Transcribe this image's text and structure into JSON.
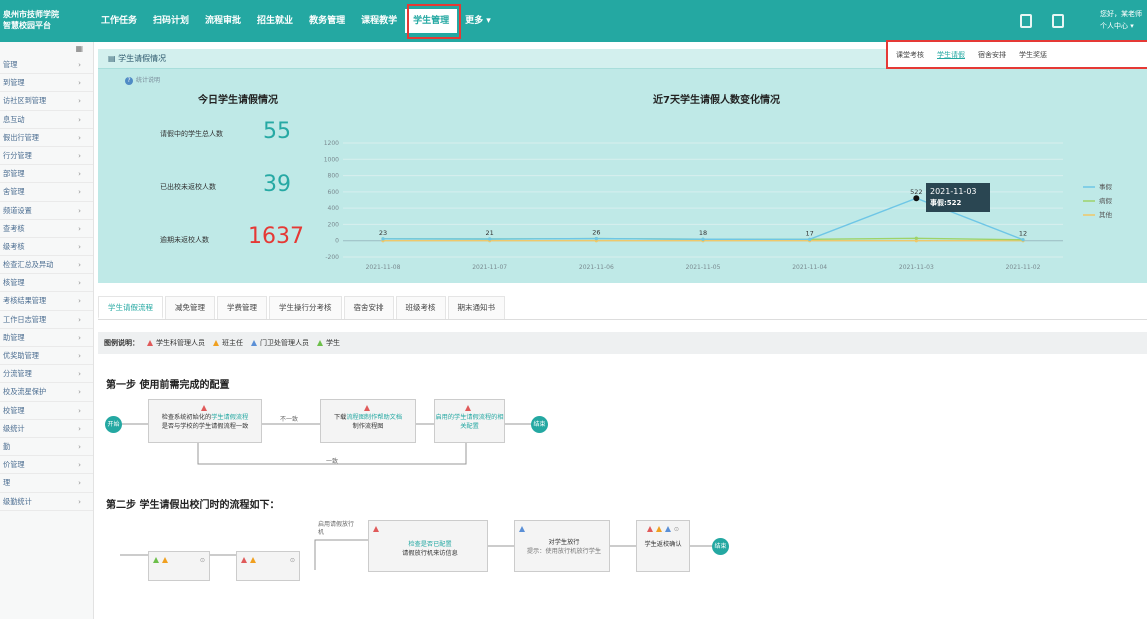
{
  "topbar": {
    "logo": [
      "泉州市技师学院",
      "智慧校园平台"
    ],
    "nav": [
      "工作任务",
      "扫码计划",
      "流程审批",
      "招生就业",
      "教务管理",
      "课程教学",
      "学生管理",
      "更多 ▾"
    ],
    "active_nav": "学生管理",
    "user_greeting": "您好，某老师",
    "user_center": "个人中心 ▾",
    "brand_color": "#24a8a2"
  },
  "sidebar": {
    "toggle_icon": "grid-icon",
    "items": [
      "管理",
      "到管理",
      "访社区到管理",
      "息互动",
      "假出行管理",
      "行分管理",
      "部管理",
      "舍管理",
      "频道设置",
      "查考核",
      "级考核",
      "检查汇总及异动",
      "核管理",
      "考核结果管理",
      "工作日志管理",
      "助管理",
      "优奖助管理",
      "分流管理",
      "校及流星保护",
      "校管理",
      "级统计",
      "勤",
      "价管理",
      "理",
      "级勤统计"
    ]
  },
  "stats": {
    "panel_title": "学生请假情况",
    "help_text": "统计说明",
    "tabs": [
      "课堂考核",
      "学生请假",
      "宿舍安排",
      "学生奖惩"
    ],
    "active_tab": "学生请假",
    "today_title": "今日学生请假情况",
    "kpis": [
      {
        "label": "请假中的学生总人数",
        "value": "55",
        "color": "#26a9a4"
      },
      {
        "label": "已出校未返校人数",
        "value": "39",
        "color": "#26a9a4"
      },
      {
        "label": "逾期未返校人数",
        "value": "1637",
        "color": "#e53935"
      }
    ],
    "tooltip_date": "2021-11-03",
    "tooltip_value": "事假:522"
  },
  "chart_data": {
    "type": "line",
    "title": "近7天学生请假人数变化情况",
    "x": [
      "2021-11-08",
      "2021-11-07",
      "2021-11-06",
      "2021-11-05",
      "2021-11-04",
      "2021-11-03",
      "2021-11-02"
    ],
    "ylim": [
      -200,
      1200
    ],
    "yticks": [
      1200,
      1000,
      800,
      600,
      400,
      200,
      0,
      -200
    ],
    "series": [
      {
        "name": "事假",
        "color": "#6ec6e6",
        "values": [
          23,
          21,
          26,
          18,
          17,
          522,
          12
        ]
      },
      {
        "name": "病假",
        "color": "#9ed36a",
        "values": [
          23,
          21,
          26,
          18,
          17,
          30,
          12
        ]
      },
      {
        "name": "其他",
        "color": "#f0c869",
        "values": [
          0,
          0,
          0,
          0,
          0,
          0,
          0
        ]
      }
    ],
    "data_labels": [
      "23",
      "21",
      "26",
      "18",
      "17",
      "522",
      "12"
    ],
    "grid": true,
    "legend": "right"
  },
  "tabs": [
    "学生请假流程",
    "减免管理",
    "学费管理",
    "学生操行分考核",
    "宿舍安排",
    "班级考核",
    "期末通知书"
  ],
  "active_tab": "学生请假流程",
  "legend": {
    "title": "图例说明：",
    "roles": [
      {
        "label": "学生科管理人员",
        "color": "#e05a5a"
      },
      {
        "label": "班主任",
        "color": "#f0a020"
      },
      {
        "label": "门卫处管理人员",
        "color": "#5a8fd6"
      },
      {
        "label": "学生",
        "color": "#6cbf4a"
      }
    ]
  },
  "step1": {
    "title": "第一步 使用前需完成的配置",
    "start": "开始",
    "end": "结束",
    "box1_prefix": "检查系统初始化的",
    "box1_link": "学生请假流程",
    "box1_rest": "是否与学校的学生请假流程一致",
    "arrow_no": "不一致",
    "arrow_yes": "一致",
    "box2_prefix": "下载",
    "box2_link": "流程图制作帮助文档",
    "box2_rest": "制作流程图",
    "box3_link": "启用的学生请假流程的相关配置"
  },
  "step2": {
    "title": "第二步 学生请假出校门时的流程如下：",
    "enable_label": "启用请假放行机",
    "box_a_link": "检查是否已配置",
    "box_a_rest": "请假放行机来访信息",
    "box_b_title": "对学生放行",
    "box_b_hint": "提示：使用放行机放行学生",
    "box_c": "学生返校确认",
    "end": "结束"
  }
}
